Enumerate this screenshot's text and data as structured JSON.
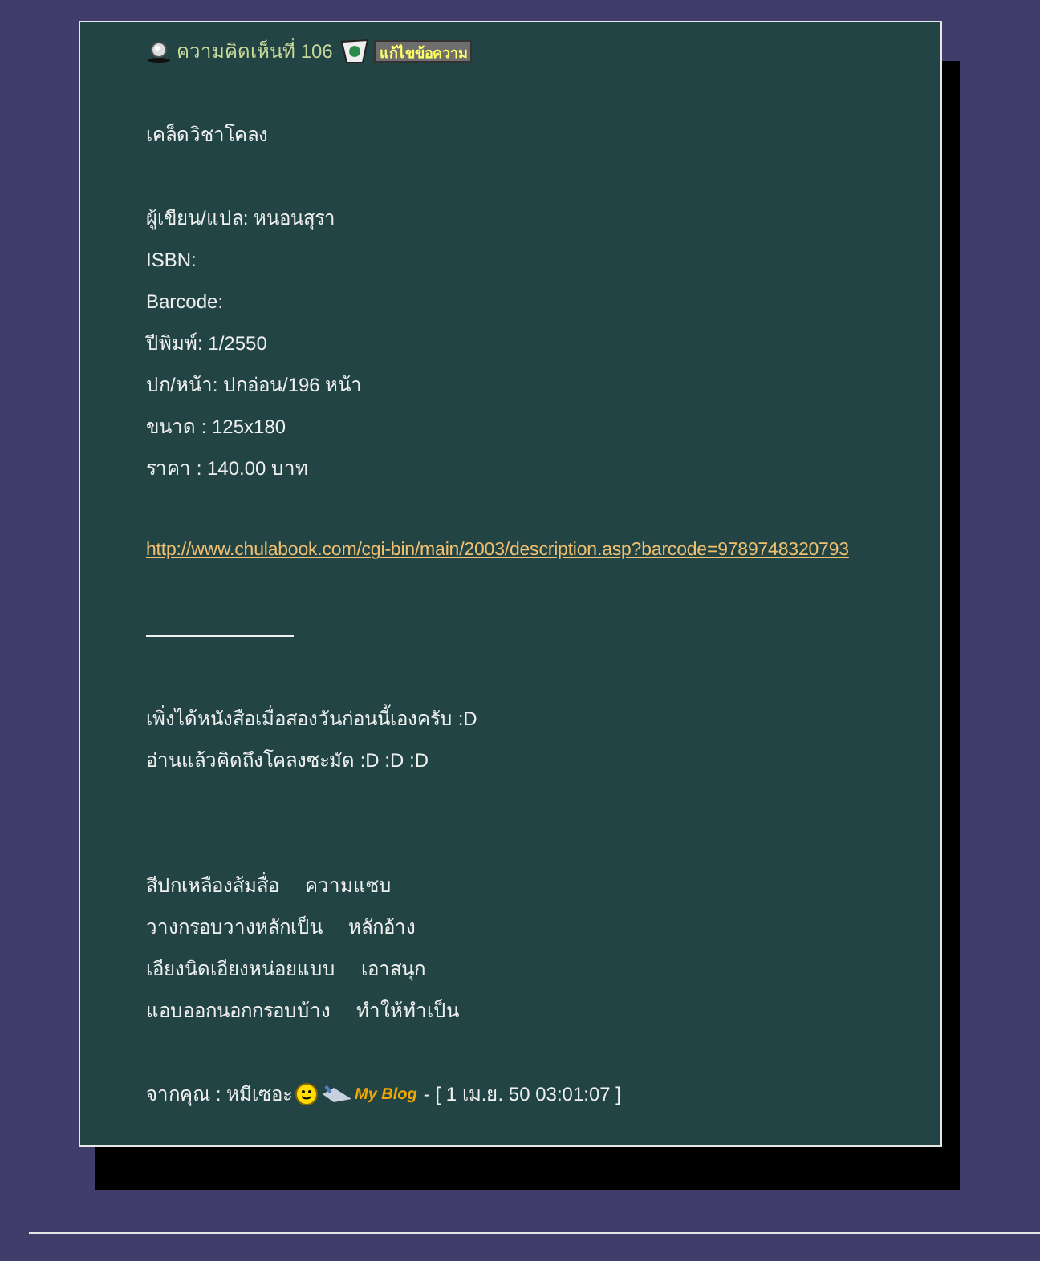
{
  "comment": {
    "heading": "ความคิดเห็นที่ 106",
    "edit_button": "แก้ไขข้อความ"
  },
  "title": "เคล็ดวิชาโคลง",
  "details": [
    "ผู้เขียน/แปล: หนอนสุรา",
    "ISBN:",
    "Barcode:",
    "ปีพิมพ์: 1/2550",
    "ปก/หน้า: ปกอ่อน/196 หน้า",
    "ขนาด : 125x180",
    "ราคา : 140.00 บาท"
  ],
  "link": "http://www.chulabook.com/cgi-bin/main/2003/description.asp?barcode=9789748320793",
  "remarks": [
    "เพิ่งได้หนังสือเมื่อสองวันก่อนนี้เองครับ :D",
    "อ่านแล้วคิดถึงโคลงซะมัด :D :D :D"
  ],
  "poem": [
    [
      "สีปกเหลืองส้มสื่อ",
      "ความแซบ"
    ],
    [
      "วางกรอบวางหลักเป็น",
      "หลักอ้าง"
    ],
    [
      "เอียงนิดเอียงหน่อยแบบ",
      "เอาสนุก"
    ],
    [
      "แอบออกนอกกรอบบ้าง",
      "ทำให้ทำเป็น"
    ]
  ],
  "footer": {
    "from": "จากคุณ : หมีเซอะ",
    "blog": "My Blog",
    "date": "- [ 1 เม.ย. 50 03:01:07 ]"
  }
}
